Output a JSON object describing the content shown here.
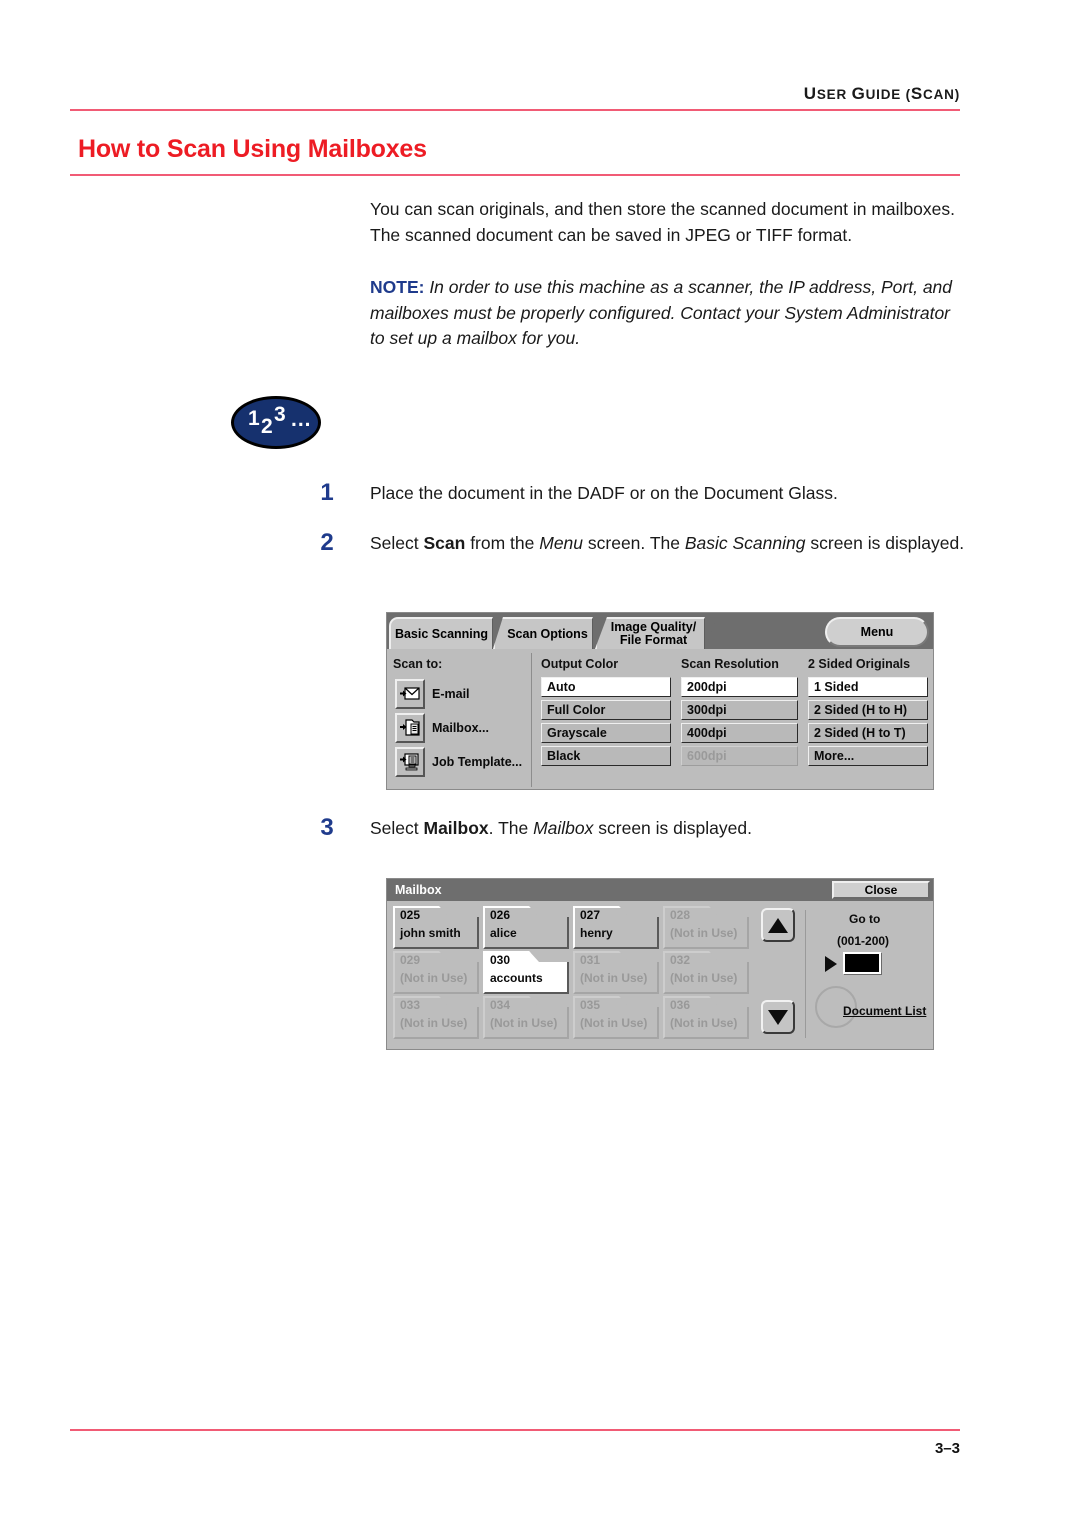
{
  "header": {
    "running_head_big1": "U",
    "running_head_rest1": "SER ",
    "running_head_big2": "G",
    "running_head_rest2": "UIDE (",
    "running_head_big3": "S",
    "running_head_rest3": "CAN)",
    "running_head_full": "USER GUIDE (SCAN)"
  },
  "title": "How to Scan Using Mailboxes",
  "footer": {
    "folio": "3–3"
  },
  "body": {
    "intro": "You can scan originals, and then store the scanned document in mailboxes.  The scanned document can be saved in JPEG or TIFF format.",
    "note_label": "NOTE:",
    "note_text": " In order to use this machine as a scanner, the IP address, Port, and mailboxes must be properly configured.  Contact your System Administrator to set up a mailbox for you."
  },
  "badge": {
    "d1": "1",
    "d2": "2",
    "d3": "3",
    "dots": "..."
  },
  "steps": [
    {
      "num": "1",
      "text_plain": "Place the document in the DADF or on the Document Glass."
    },
    {
      "num": "2",
      "text_plain": "Select Scan from the Menu screen. The Basic Scanning screen is displayed."
    },
    {
      "num": "3",
      "text_plain": "Select Mailbox. The Mailbox screen is displayed."
    }
  ],
  "step2_parts": {
    "a": "Select ",
    "b": "Scan",
    "c": " from the ",
    "d": "Menu",
    "e": " screen. The ",
    "f": "Basic Scanning",
    "g": " screen is displayed."
  },
  "step3_parts": {
    "a": "Select ",
    "b": "Mailbox",
    "c": ". The ",
    "d": "Mailbox",
    "e": " screen is displayed."
  },
  "scan_panel": {
    "tabs": [
      {
        "label": "Basic Scanning",
        "selected": true
      },
      {
        "label": "Scan Options",
        "selected": false
      }
    ],
    "tab_iq_line1": "Image Quality/",
    "tab_iq_line2": "File Format",
    "menu_button": "Menu",
    "scan_to_header": "Scan to:",
    "scan_to_items": [
      {
        "label": "E-mail",
        "icon": "envelope-icon"
      },
      {
        "label": "Mailbox...",
        "icon": "mailbox-icon"
      },
      {
        "label": "Job Template...",
        "icon": "job-template-icon"
      }
    ],
    "columns": [
      {
        "header": "Output Color",
        "options": [
          {
            "label": "Auto",
            "selected": true,
            "disabled": false
          },
          {
            "label": "Full Color",
            "selected": false,
            "disabled": false
          },
          {
            "label": "Grayscale",
            "selected": false,
            "disabled": false
          },
          {
            "label": "Black",
            "selected": false,
            "disabled": false
          }
        ]
      },
      {
        "header": "Scan Resolution",
        "options": [
          {
            "label": "200dpi",
            "selected": true,
            "disabled": false
          },
          {
            "label": "300dpi",
            "selected": false,
            "disabled": false
          },
          {
            "label": "400dpi",
            "selected": false,
            "disabled": false
          },
          {
            "label": "600dpi",
            "selected": false,
            "disabled": true
          }
        ]
      },
      {
        "header": "2 Sided Originals",
        "options": [
          {
            "label": "1 Sided",
            "selected": true,
            "disabled": false
          },
          {
            "label": "2 Sided (H to H)",
            "selected": false,
            "disabled": false
          },
          {
            "label": "2 Sided (H to T)",
            "selected": false,
            "disabled": false
          },
          {
            "label": "More...",
            "selected": false,
            "disabled": false
          }
        ]
      }
    ]
  },
  "mailbox_panel": {
    "title": "Mailbox",
    "close_button": "Close",
    "goto_label": "Go to",
    "goto_range": "(001-200)",
    "goto_value": "",
    "document_list_label": "Document List",
    "cells": [
      {
        "num": "025",
        "name": "john smith",
        "state": "used"
      },
      {
        "num": "026",
        "name": "alice",
        "state": "used"
      },
      {
        "num": "027",
        "name": "henry",
        "state": "used"
      },
      {
        "num": "028",
        "name": "(Not in Use)",
        "state": "free"
      },
      {
        "num": "029",
        "name": "(Not in Use)",
        "state": "free"
      },
      {
        "num": "030",
        "name": "accounts",
        "state": "selected"
      },
      {
        "num": "031",
        "name": "(Not in Use)",
        "state": "free"
      },
      {
        "num": "032",
        "name": "(Not in Use)",
        "state": "free"
      },
      {
        "num": "033",
        "name": "(Not in Use)",
        "state": "free"
      },
      {
        "num": "034",
        "name": "(Not in Use)",
        "state": "free"
      },
      {
        "num": "035",
        "name": "(Not in Use)",
        "state": "free"
      },
      {
        "num": "036",
        "name": "(Not in Use)",
        "state": "free"
      }
    ]
  },
  "colors": {
    "title_red": "#ED1C24",
    "rule_pink": "#F15B75",
    "step_blue": "#1F3B8C",
    "badge_navy": "#16316E",
    "device_grey": "#bdbdbd",
    "device_dark": "#6e6e6e"
  }
}
